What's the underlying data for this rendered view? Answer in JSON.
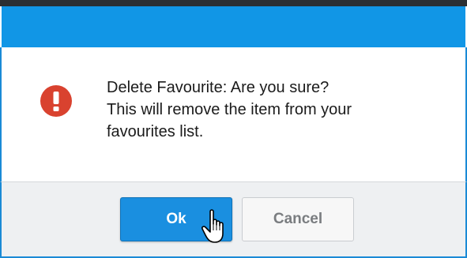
{
  "dialog": {
    "message_line1": "Delete Favourite: Are you sure?",
    "message_line2": "This will remove the item from your",
    "message_line3": "favourites list.",
    "ok_label": "Ok",
    "cancel_label": "Cancel"
  },
  "icons": {
    "alert": "exclamation-circle-icon",
    "cursor": "hand-pointer-icon"
  },
  "colors": {
    "title_bar": "#1196e6",
    "alert_icon": "#d9422f",
    "ok_button": "#1a8fe0",
    "footer": "#eef0f2"
  }
}
